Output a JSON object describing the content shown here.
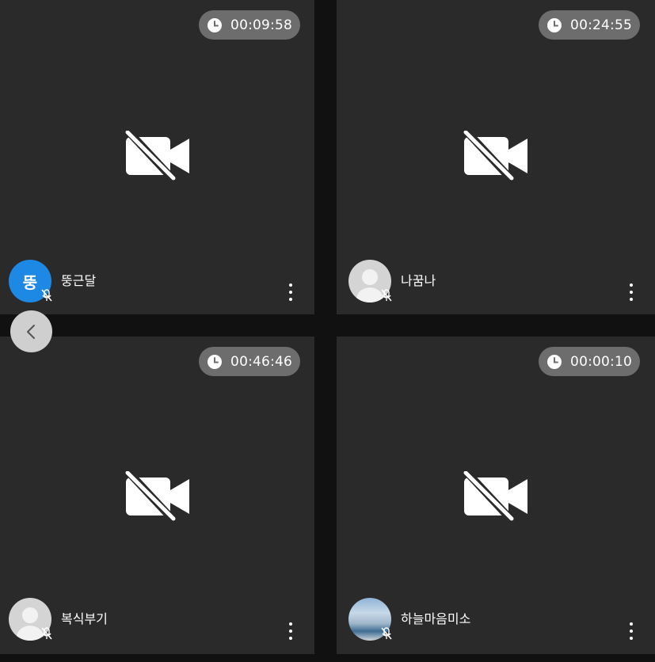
{
  "tiles": [
    {
      "timer": "00:09:58",
      "name": "뚱근달",
      "avatar_letter": "뚱",
      "avatar_type": "letter",
      "camera": "camera-off",
      "mic": "mic-off"
    },
    {
      "timer": "00:24:55",
      "name": "나꿈나",
      "avatar_type": "person",
      "camera": "camera-off",
      "mic": "mic-off"
    },
    {
      "timer": "00:46:46",
      "name": "복식부기",
      "avatar_type": "person",
      "camera": "camera-off",
      "mic": "mic-off"
    },
    {
      "timer": "00:00:10",
      "name": "하늘마음미소",
      "avatar_type": "photo",
      "camera": "camera-off",
      "mic": "mic-off"
    }
  ],
  "icons": {
    "timer": "clock-icon",
    "camera": "video-off-icon",
    "mic": "mic-off-icon",
    "more": "more-vertical-icon",
    "back": "chevron-left-icon"
  },
  "colors": {
    "tile_bg": "#2a2a2a",
    "gap_bg": "#111111",
    "timer_bg": "#6d6d6d",
    "avatar_accent": "#1e88e5",
    "back_button_bg": "#cfcfcf"
  }
}
